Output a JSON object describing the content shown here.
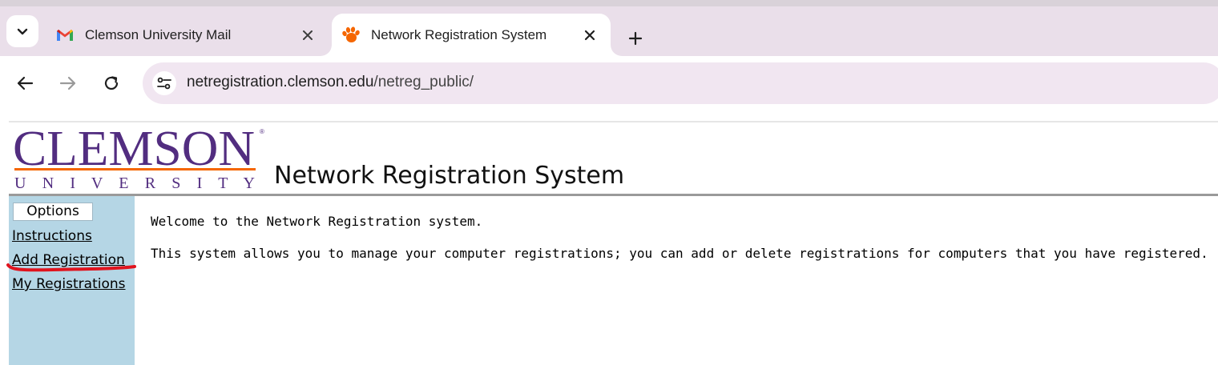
{
  "browser": {
    "tabs": [
      {
        "title": "Clemson University Mail",
        "favicon": "gmail-icon",
        "active": false
      },
      {
        "title": "Network Registration System",
        "favicon": "tiger-paw-icon",
        "active": true
      }
    ],
    "address_bar": {
      "host": "netregistration.clemson.edu",
      "path": "/netreg_public/"
    },
    "colors": {
      "tabstrip": "#eadfea",
      "omnibox": "#f1e6f1"
    }
  },
  "page": {
    "logo": {
      "wordmark": "CLEMSON",
      "subtitle": "U N I V E R S I T Y",
      "registered": "®",
      "colors": {
        "purple": "#522d80",
        "orange": "#f56600"
      }
    },
    "title": "Network Registration System",
    "sidebar": {
      "header": "Options",
      "links": [
        "Instructions",
        "Add Registration",
        "My Registrations"
      ],
      "color": "#b5d6e5"
    },
    "main": {
      "welcome": "Welcome to the Network Registration system.",
      "description": "This system allows you to manage your computer registrations; you can add or delete registrations for computers that you have registered."
    },
    "annotation_color": "#e0141e"
  }
}
